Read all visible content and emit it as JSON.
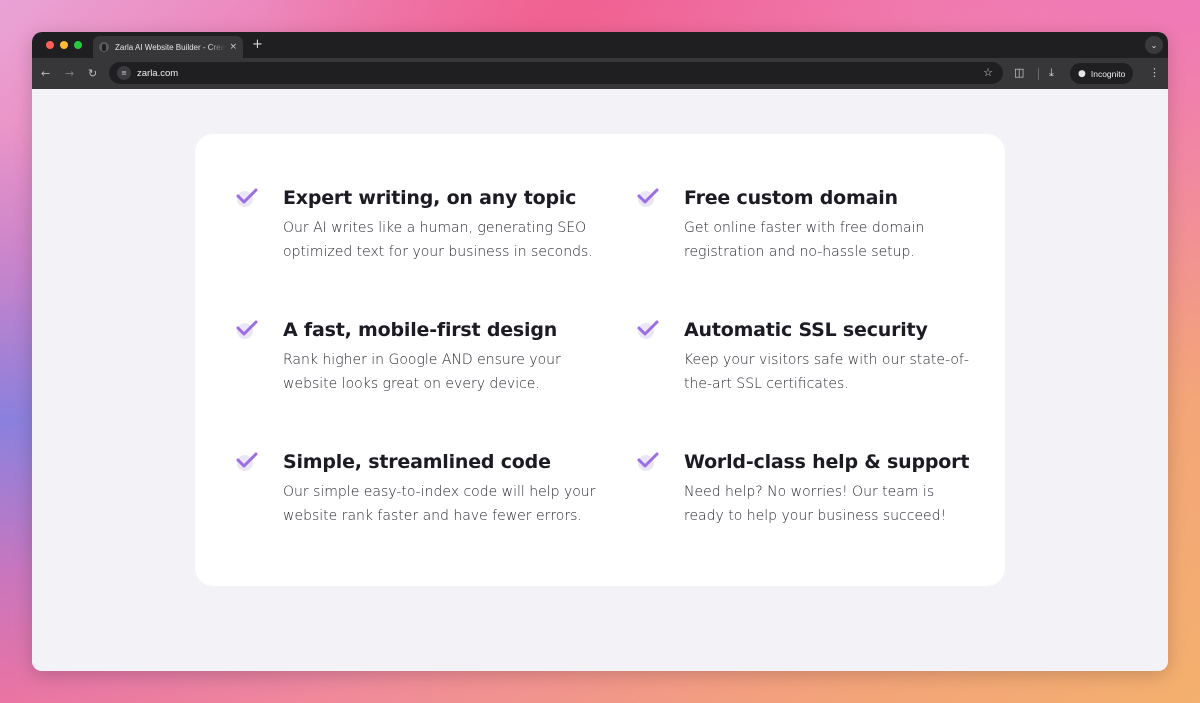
{
  "browser": {
    "tab_title": "Zarla AI Website Builder - Create a Website",
    "tab_close": "×",
    "new_tab": "+",
    "url": "zarla.com",
    "incognito_label": "Incognito",
    "tab_menu_icon": "chevron-down-icon",
    "icons": [
      "back-arrow-icon",
      "forward-arrow-icon",
      "reload-icon",
      "site-info-icon",
      "bookmark-star-icon",
      "extensions-icon",
      "download-icon",
      "incognito-icon",
      "menu-kebab-icon"
    ]
  },
  "colors": {
    "check_primary": "#9b6ee6",
    "check_circle": "#ebe6f5",
    "title": "#1c1b24",
    "text": "#2a2a33",
    "card": "#ffffff",
    "page_bg": "#f3f2f7"
  },
  "features": [
    {
      "title": "Expert writing, on any topic",
      "line1": "Our AI writes like a human, generating SEO",
      "line2": "optimized text for your business in seconds."
    },
    {
      "title": "Free custom domain",
      "line1": "Get online faster with free domain",
      "line2": "registration and no-hassle setup."
    },
    {
      "title": "A fast, mobile-first design",
      "line1": "Rank higher in Google AND ensure your",
      "line2": "website looks great on every device."
    },
    {
      "title": "Automatic SSL security",
      "line1": "Keep your visitors safe with our state-of-",
      "line2": "the-art SSL certificates."
    },
    {
      "title": "Simple, streamlined code",
      "line1": "Our simple easy-to-index code will help your",
      "line2": "website rank faster and have fewer errors."
    },
    {
      "title": "World-class help & support",
      "line1": "Need help? No worries! Our team is",
      "line2": "ready to help your business succeed!"
    }
  ]
}
